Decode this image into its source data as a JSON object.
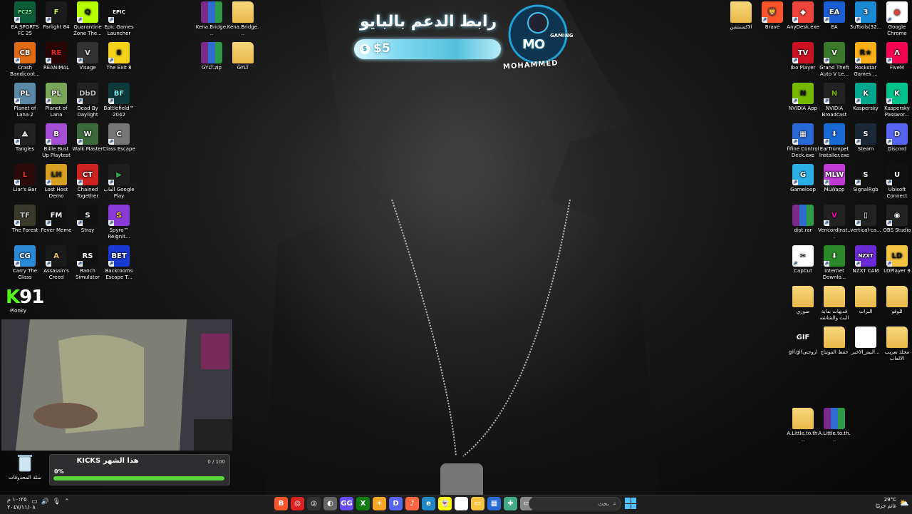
{
  "desktop_left": [
    {
      "label": "EA SPORTS FC 25",
      "icon": "fc25-icon",
      "glyph": "FC25",
      "bg": "#0a5f3a",
      "fg": "#6aff9a",
      "shortcut": true
    },
    {
      "label": "Farlight 84",
      "icon": "farlight-icon",
      "glyph": "F",
      "bg": "#1b1b1b",
      "fg": "#c6ff3a",
      "shortcut": true
    },
    {
      "label": "Quarantine Zone The...",
      "icon": "quarantine-icon",
      "glyph": "Q",
      "bg": "#b6ff00",
      "fg": "#111",
      "shortcut": true
    },
    {
      "label": "Epic Games Launcher",
      "icon": "epic-icon",
      "glyph": "EPIC",
      "bg": "#111",
      "fg": "#fff",
      "shortcut": true
    },
    {
      "label": "Crash Bandicoot...",
      "icon": "crash-icon",
      "glyph": "CB",
      "bg": "#e06b12",
      "fg": "#fff",
      "shortcut": true
    },
    {
      "label": "REANIMAL",
      "icon": "reanimal-icon",
      "glyph": "RE",
      "bg": "#2a0505",
      "fg": "#e22",
      "shortcut": true
    },
    {
      "label": "Visage",
      "icon": "visage-icon",
      "glyph": "V",
      "bg": "#333",
      "fg": "#ddd",
      "shortcut": true
    },
    {
      "label": "The Exit 8",
      "icon": "exit8-icon",
      "glyph": "8",
      "bg": "#f4d21a",
      "fg": "#111",
      "shortcut": true
    },
    {
      "label": "Planet of Lana 2",
      "icon": "lana2-icon",
      "glyph": "PL",
      "bg": "#5a8aa8",
      "fg": "#fff",
      "shortcut": true
    },
    {
      "label": "Planet of Lana",
      "icon": "lana-icon",
      "glyph": "PL",
      "bg": "#7aa65a",
      "fg": "#fff",
      "shortcut": true
    },
    {
      "label": "Dead By Daylight",
      "icon": "dbd-icon",
      "glyph": "DbD",
      "bg": "#222",
      "fg": "#bbb",
      "shortcut": true
    },
    {
      "label": "Battlefield™ 2042",
      "icon": "battlefield-icon",
      "glyph": "BF",
      "bg": "#0c3a3a",
      "fg": "#7ff",
      "shortcut": true
    },
    {
      "label": "Tangles",
      "icon": "tangles-icon",
      "glyph": "⟁",
      "bg": "#222",
      "fg": "#fff",
      "shortcut": true
    },
    {
      "label": "Billie Bust Up Playtest",
      "icon": "billie-icon",
      "glyph": "B",
      "bg": "#a64fd6",
      "fg": "#fff",
      "shortcut": true
    },
    {
      "label": "Walk Master",
      "icon": "walkmaster-icon",
      "glyph": "W",
      "bg": "#3d6a3d",
      "fg": "#fff",
      "shortcut": true
    },
    {
      "label": "Class Escape",
      "icon": "classescape-icon",
      "glyph": "C",
      "bg": "#777",
      "fg": "#fff",
      "shortcut": true
    },
    {
      "label": "Liar's Bar",
      "icon": "liarsbar-icon",
      "glyph": "L",
      "bg": "#2a0a0a",
      "fg": "#e33",
      "shortcut": true
    },
    {
      "label": "Lost Host Demo",
      "icon": "losthost-icon",
      "glyph": "LH",
      "bg": "#d8a020",
      "fg": "#222",
      "shortcut": true
    },
    {
      "label": "Chained Together",
      "icon": "chained-icon",
      "glyph": "CT",
      "bg": "#c22",
      "fg": "#fff",
      "shortcut": true
    },
    {
      "label": "ألعاب Google Play",
      "icon": "googleplay-icon",
      "glyph": "▶",
      "bg": "#1f1f1f",
      "fg": "#34a853",
      "shortcut": true
    },
    {
      "label": "The Forest",
      "icon": "theforest-icon",
      "glyph": "TF",
      "bg": "#3a3a2a",
      "fg": "#ccc",
      "shortcut": true
    },
    {
      "label": "Fever Meme",
      "icon": "fevermeme-icon",
      "glyph": "FM",
      "bg": "#111",
      "fg": "#fff",
      "shortcut": true
    },
    {
      "label": "Stray",
      "icon": "stray-icon",
      "glyph": "S",
      "bg": "#111",
      "fg": "#fff",
      "shortcut": true
    },
    {
      "label": "Spyro™ Reignit...",
      "icon": "spyro-icon",
      "glyph": "S",
      "bg": "#8a3ad6",
      "fg": "#ffd23a",
      "shortcut": true
    },
    {
      "label": "Carry The Glass",
      "icon": "carryglass-icon",
      "glyph": "CG",
      "bg": "#2a8ad6",
      "fg": "#fff",
      "shortcut": true
    },
    {
      "label": "Assassin's Creed Mirage",
      "icon": "acmirage-icon",
      "glyph": "A",
      "bg": "#1a1a1a",
      "fg": "#e8c060",
      "shortcut": true
    },
    {
      "label": "Ranch Simulator",
      "icon": "ranchsim-icon",
      "glyph": "RS",
      "bg": "#111",
      "fg": "#fff",
      "shortcut": true
    },
    {
      "label": "Backrooms Escape T...",
      "icon": "backrooms-icon",
      "glyph": "BET",
      "bg": "#1a3ad6",
      "fg": "#fff",
      "shortcut": true
    }
  ],
  "desktop_middle": [
    {
      "label": "Kena.Bridge...",
      "icon": "winrar-icon",
      "type": "rar"
    },
    {
      "label": "Kena.Bridge...",
      "icon": "folder-icon",
      "type": "folder"
    },
    {
      "label": "GYLT.zip",
      "icon": "winrar-icon",
      "type": "rar"
    },
    {
      "label": "GYLT",
      "icon": "folder-icon",
      "type": "folder"
    }
  ],
  "desktop_right": [
    {
      "label": "الاكستنشن",
      "icon": "folder-icon",
      "glyph": "",
      "bg": "",
      "fg": "",
      "type": "folder"
    },
    {
      "label": "Brave",
      "icon": "brave-icon",
      "glyph": "🦁",
      "bg": "#fb542b",
      "fg": "#fff",
      "shortcut": true
    },
    {
      "label": "AnyDesk.exe",
      "icon": "anydesk-icon",
      "glyph": "◆",
      "bg": "#ef443b",
      "fg": "#fff",
      "shortcut": true
    },
    {
      "label": "EA",
      "icon": "ea-icon",
      "glyph": "EA",
      "bg": "#1a5fd6",
      "fg": "#fff",
      "shortcut": true
    },
    {
      "label": "3uTools(32...",
      "icon": "3utools-icon",
      "glyph": "3",
      "bg": "#1a8ad6",
      "fg": "#fff",
      "shortcut": true
    },
    {
      "label": "Google Chrome",
      "icon": "chrome-icon",
      "glyph": "●",
      "bg": "#fff",
      "fg": "#db4437",
      "shortcut": true
    },
    {
      "label": "",
      "icon": "",
      "glyph": "",
      "bg": "",
      "fg": "",
      "type": "empty"
    },
    {
      "label": "Ibo Player",
      "icon": "iboplayer-icon",
      "glyph": "TV",
      "bg": "#c12",
      "fg": "#fff",
      "shortcut": true
    },
    {
      "label": "Grand Theft Auto V Le...",
      "icon": "gtav-icon",
      "glyph": "V",
      "bg": "#3a7a2a",
      "fg": "#fff",
      "shortcut": true
    },
    {
      "label": "Rockstar Games ...",
      "icon": "rockstar-icon",
      "glyph": "R★",
      "bg": "#fcaf17",
      "fg": "#111",
      "shortcut": true
    },
    {
      "label": "FiveM",
      "icon": "fivem-icon",
      "glyph": "Λ",
      "bg": "#f40552",
      "fg": "#fff",
      "shortcut": true
    },
    {
      "label": "",
      "icon": "",
      "glyph": "",
      "bg": "",
      "fg": "",
      "type": "empty"
    },
    {
      "label": "NVIDIA App",
      "icon": "nvidia-icon",
      "glyph": "N",
      "bg": "#76b900",
      "fg": "#111",
      "shortcut": true
    },
    {
      "label": "NVIDIA Broadcast",
      "icon": "nvbroadcast-icon",
      "glyph": "N",
      "bg": "#222",
      "fg": "#76b900",
      "shortcut": true
    },
    {
      "label": "Kaspersky",
      "icon": "kaspersky-icon",
      "glyph": "K",
      "bg": "#00a88e",
      "fg": "#fff",
      "shortcut": true
    },
    {
      "label": "Kaspersky Passwor...",
      "icon": "kasperskypw-icon",
      "glyph": "K",
      "bg": "#00c48c",
      "fg": "#fff",
      "shortcut": true
    },
    {
      "label": "",
      "icon": "",
      "glyph": "",
      "bg": "",
      "fg": "",
      "type": "empty"
    },
    {
      "label": "fifine Control Deck.exe",
      "icon": "fifine-icon",
      "glyph": "▦",
      "bg": "#2a6ad6",
      "fg": "#fff",
      "shortcut": true
    },
    {
      "label": "EarTrumpet Installer.exe",
      "icon": "eartrumpet-icon",
      "glyph": "⬇",
      "bg": "#1a6ad6",
      "fg": "#fff",
      "shortcut": true
    },
    {
      "label": "Steam",
      "icon": "steam-icon",
      "glyph": "S",
      "bg": "#1b2838",
      "fg": "#fff",
      "shortcut": true
    },
    {
      "label": "Discord",
      "icon": "discord-icon",
      "glyph": "D",
      "bg": "#5865f2",
      "fg": "#fff",
      "shortcut": true
    },
    {
      "label": "",
      "icon": "",
      "glyph": "",
      "bg": "",
      "fg": "",
      "type": "empty"
    },
    {
      "label": "Gameloop",
      "icon": "gameloop-icon",
      "glyph": "G",
      "bg": "#2ab0e6",
      "fg": "#fff",
      "shortcut": true
    },
    {
      "label": "MLWapp",
      "icon": "mlwapp-icon",
      "glyph": "MLW",
      "bg": "#c23ad6",
      "fg": "#fff",
      "shortcut": true
    },
    {
      "label": "SignalRgb",
      "icon": "signalrgb-icon",
      "glyph": "S",
      "bg": "#111",
      "fg": "#fff",
      "shortcut": true
    },
    {
      "label": "Ubisoft Connect",
      "icon": "ubisoft-icon",
      "glyph": "U",
      "bg": "#111",
      "fg": "#fff",
      "shortcut": true
    },
    {
      "label": "",
      "icon": "",
      "glyph": "",
      "bg": "",
      "fg": "",
      "type": "empty"
    },
    {
      "label": "dist.rar",
      "icon": "winrar-icon",
      "glyph": "",
      "bg": "",
      "fg": "",
      "type": "rar"
    },
    {
      "label": "VencordInst...",
      "icon": "vencord-icon",
      "glyph": "V",
      "bg": "#222",
      "fg": "#f0a",
      "shortcut": true
    },
    {
      "label": "vertical-ca...",
      "icon": "vertical-icon",
      "glyph": "▯",
      "bg": "#222",
      "fg": "#fff",
      "shortcut": true
    },
    {
      "label": "OBS Studio",
      "icon": "obs-icon",
      "glyph": "◉",
      "bg": "#222",
      "fg": "#fff",
      "shortcut": true
    },
    {
      "label": "",
      "icon": "",
      "glyph": "",
      "bg": "",
      "fg": "",
      "type": "empty"
    },
    {
      "label": "CapCut",
      "icon": "capcut-icon",
      "glyph": "✂",
      "bg": "#fff",
      "fg": "#111",
      "shortcut": true
    },
    {
      "label": "Internet Downlo...",
      "icon": "idm-icon",
      "glyph": "⬇",
      "bg": "#2a8a2a",
      "fg": "#fff",
      "shortcut": true
    },
    {
      "label": "NZXT CAM",
      "icon": "nzxt-icon",
      "glyph": "NZXT",
      "bg": "#6a2ad6",
      "fg": "#fff",
      "shortcut": true
    },
    {
      "label": "LDPlayer 9",
      "icon": "ldplayer-icon",
      "glyph": "LD",
      "bg": "#f5c542",
      "fg": "#111",
      "shortcut": true
    },
    {
      "label": "",
      "icon": "",
      "glyph": "",
      "bg": "",
      "fg": "",
      "type": "empty"
    },
    {
      "label": "صوري",
      "icon": "folder-icon",
      "glyph": "",
      "bg": "",
      "fg": "",
      "type": "folder"
    },
    {
      "label": "قديهات بداية البث والشاشه",
      "icon": "folder-icon",
      "glyph": "",
      "bg": "",
      "fg": "",
      "type": "folder"
    },
    {
      "label": "البرات",
      "icon": "folder-icon",
      "glyph": "",
      "bg": "",
      "fg": "",
      "type": "folder"
    },
    {
      "label": "للوقو",
      "icon": "folder-icon",
      "glyph": "",
      "bg": "",
      "fg": "",
      "type": "folder"
    },
    {
      "label": "",
      "icon": "",
      "glyph": "",
      "bg": "",
      "fg": "",
      "type": "empty"
    },
    {
      "label": "gif.gifاروحتي",
      "icon": "gif-icon",
      "glyph": "GIF",
      "bg": "#111",
      "fg": "#fff",
      "type": "plain"
    },
    {
      "label": "حفظ المونتاج",
      "icon": "folder-icon",
      "glyph": "",
      "bg": "",
      "fg": "",
      "type": "folder"
    },
    {
      "label": "البيم_الاخير...",
      "icon": "document-icon",
      "glyph": "",
      "bg": "#fff",
      "fg": "#111",
      "type": "plain"
    },
    {
      "label": "مجلد تعريب الالعاب",
      "icon": "folder-icon",
      "glyph": "",
      "bg": "",
      "fg": "",
      "type": "folder"
    },
    {
      "label": "",
      "icon": "",
      "glyph": "",
      "bg": "",
      "fg": "",
      "type": "empty"
    },
    {
      "label": "",
      "icon": "",
      "glyph": "",
      "bg": "",
      "fg": "",
      "type": "empty"
    },
    {
      "label": "A.Little.to.th...",
      "icon": "folder-icon",
      "glyph": "",
      "bg": "",
      "fg": "",
      "type": "folder"
    },
    {
      "label": "A.Little.to.th...",
      "icon": "winrar-icon",
      "glyph": "",
      "bg": "",
      "fg": "",
      "type": "rar"
    }
  ],
  "donation": {
    "title": "رابط الدعم بالبايو",
    "currency_glyph": "$",
    "amount": "$5"
  },
  "logo": {
    "big": "MO",
    "top": "GAMING",
    "name": "MOHAMMED"
  },
  "kick_counter": {
    "k": "K",
    "number": "91"
  },
  "plonky_label": "Plonky",
  "recycle_bin": {
    "label": "سلة المحذوفات"
  },
  "kicks_goal": {
    "title": "KICKS هذا الشهر",
    "count": "0 / 100",
    "percent_label": "0%",
    "progress": 0
  },
  "taskbar": {
    "time": "١٠:٢٥ م",
    "date": "٢٠٤٧/١١/٠٨",
    "search_placeholder": "بحث",
    "weather_temp": "29°C",
    "weather_desc": "غائم جزئيًا",
    "apps": [
      {
        "icon": "brave-taskbar-icon",
        "glyph": "B",
        "bg": "#fb542b"
      },
      {
        "icon": "vpn-taskbar-icon",
        "glyph": "◎",
        "bg": "#d22"
      },
      {
        "icon": "chatgpt-taskbar-icon",
        "glyph": "◎",
        "bg": "#333"
      },
      {
        "icon": "app-taskbar-icon",
        "glyph": "◐",
        "bg": "#666"
      },
      {
        "icon": "steelseries-taskbar-icon",
        "glyph": "GG",
        "bg": "#6a4aff"
      },
      {
        "icon": "xbox-taskbar-icon",
        "glyph": "X",
        "bg": "#107c10"
      },
      {
        "icon": "weather-app-taskbar-icon",
        "glyph": "☀",
        "bg": "#f5a623"
      },
      {
        "icon": "discord-taskbar-icon",
        "glyph": "D",
        "bg": "#5865f2"
      },
      {
        "icon": "itunes-taskbar-icon",
        "glyph": "♪",
        "bg": "#f64"
      },
      {
        "icon": "edge-taskbar-icon",
        "glyph": "e",
        "bg": "#1e88c8"
      },
      {
        "icon": "snapchat-taskbar-icon",
        "glyph": "👻",
        "bg": "#fffc00"
      },
      {
        "icon": "chrome-taskbar-icon",
        "glyph": "●",
        "bg": "#fff"
      },
      {
        "icon": "explorer-taskbar-icon",
        "glyph": "▭",
        "bg": "#f5c542"
      },
      {
        "icon": "store-taskbar-icon",
        "glyph": "▦",
        "bg": "#2a6ad6"
      },
      {
        "icon": "game-taskbar-icon",
        "glyph": "✚",
        "bg": "#4a8"
      },
      {
        "icon": "window-taskbar-icon",
        "glyph": "▭",
        "bg": "#888"
      }
    ]
  },
  "colors": {
    "kick_green": "#53fc18",
    "accent_cyan": "#54c1dc"
  }
}
